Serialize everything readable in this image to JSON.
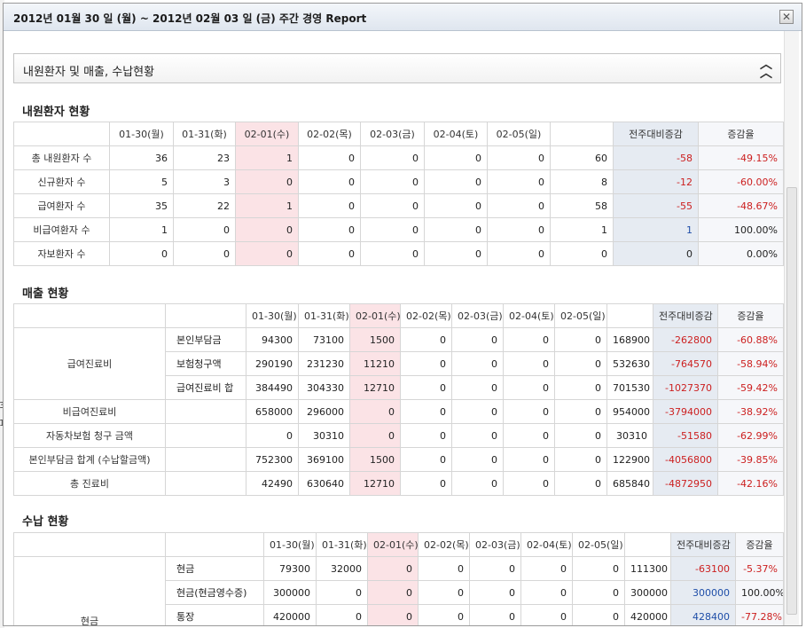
{
  "dialog": {
    "title": "2012년 01월 30 일 (월) ~ 2012년 02월 03 일 (금) 주간 경영 Report",
    "close_glyph": "✕"
  },
  "section": {
    "title": "내원환자 및 매출, 수납현황",
    "collapse_glyph": "︽"
  },
  "background": {
    "t1": "3",
    "t2": "1"
  },
  "patients": {
    "title": "내원환자 현황",
    "headers": [
      "01-30(월)",
      "01-31(화)",
      "02-01(수)",
      "02-02(목)",
      "02-03(금)",
      "02-04(토)",
      "02-05(일)",
      "",
      "전주대비증감",
      "증감율"
    ],
    "rows": [
      {
        "label": "총 내원환자 수",
        "values": [
          "36",
          "23",
          "1",
          "0",
          "0",
          "0",
          "0",
          "60"
        ],
        "diff": "-58",
        "rate": "-49.15%"
      },
      {
        "label": "신규환자 수",
        "values": [
          "5",
          "3",
          "0",
          "0",
          "0",
          "0",
          "0",
          "8"
        ],
        "diff": "-12",
        "rate": "-60.00%"
      },
      {
        "label": "급여환자 수",
        "values": [
          "35",
          "22",
          "1",
          "0",
          "0",
          "0",
          "0",
          "58"
        ],
        "diff": "-55",
        "rate": "-48.67%"
      },
      {
        "label": "비급여환자 수",
        "values": [
          "1",
          "0",
          "0",
          "0",
          "0",
          "0",
          "0",
          "1"
        ],
        "diff": "1",
        "rate": "100.00%"
      },
      {
        "label": "자보환자 수",
        "values": [
          "0",
          "0",
          "0",
          "0",
          "0",
          "0",
          "0",
          "0"
        ],
        "diff": "0",
        "rate": "0.00%"
      }
    ]
  },
  "sales": {
    "title": "매출 현황",
    "headers": [
      "01-30(월)",
      "01-31(화)",
      "02-01(수)",
      "02-02(목)",
      "02-03(금)",
      "02-04(토)",
      "02-05(일)",
      "",
      "전주대비증감",
      "증감율"
    ],
    "group_label": "급여진료비",
    "group_rows": [
      {
        "sub": "본인부담금",
        "values": [
          "94300",
          "73100",
          "1500",
          "0",
          "0",
          "0",
          "0",
          "168900"
        ],
        "diff": "-262800",
        "rate": "-60.88%"
      },
      {
        "sub": "보험청구액",
        "values": [
          "290190",
          "231230",
          "11210",
          "0",
          "0",
          "0",
          "0",
          "532630"
        ],
        "diff": "-764570",
        "rate": "-58.94%"
      },
      {
        "sub": "급여진료비 합",
        "values": [
          "384490",
          "304330",
          "12710",
          "0",
          "0",
          "0",
          "0",
          "701530"
        ],
        "diff": "-1027370",
        "rate": "-59.42%"
      }
    ],
    "rows": [
      {
        "label": "비급여진료비",
        "values": [
          "658000",
          "296000",
          "0",
          "0",
          "0",
          "0",
          "0",
          "954000"
        ],
        "diff": "-3794000",
        "rate": "-38.92%"
      },
      {
        "label": "자동차보험 청구 금액",
        "values": [
          "0",
          "30310",
          "0",
          "0",
          "0",
          "0",
          "0",
          "30310"
        ],
        "diff": "-51580",
        "rate": "-62.99%"
      },
      {
        "label": "본인부담금 합계 (수납할금액)",
        "values": [
          "752300",
          "369100",
          "1500",
          "0",
          "0",
          "0",
          "0",
          "122900"
        ],
        "diff": "-4056800",
        "rate": "-39.85%"
      },
      {
        "label": "총 진료비",
        "values": [
          "42490",
          "630640",
          "12710",
          "0",
          "0",
          "0",
          "0",
          "685840"
        ],
        "diff": "-4872950",
        "rate": "-42.16%"
      }
    ]
  },
  "receipts": {
    "title": "수납 현황",
    "headers": [
      "01-30(월)",
      "01-31(화)",
      "02-01(수)",
      "02-02(목)",
      "02-03(금)",
      "02-04(토)",
      "02-05(일)",
      "",
      "전주대비증감",
      "증감율"
    ],
    "group_label": "현금",
    "group_rows": [
      {
        "sub": "현금",
        "values": [
          "79300",
          "32000",
          "0",
          "0",
          "0",
          "0",
          "0",
          "111300"
        ],
        "diff": "-63100",
        "rate": "-5.37%"
      },
      {
        "sub": "현금(현금영수증)",
        "values": [
          "300000",
          "0",
          "0",
          "0",
          "0",
          "0",
          "0",
          "300000"
        ],
        "diff": "300000",
        "rate": "100.00%"
      },
      {
        "sub": "통장",
        "values": [
          "420000",
          "0",
          "0",
          "0",
          "0",
          "0",
          "0",
          "420000"
        ],
        "diff": "428400",
        "rate": "-77.28%"
      }
    ]
  }
}
